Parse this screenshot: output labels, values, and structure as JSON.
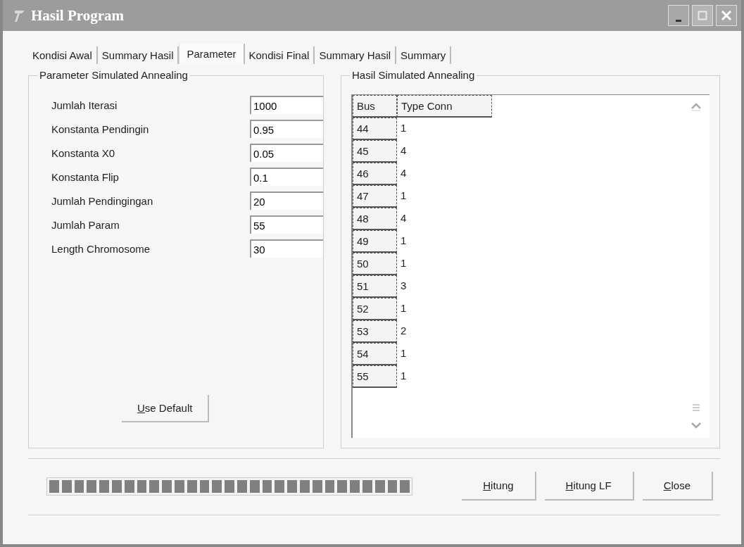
{
  "window": {
    "title": "Hasil Program"
  },
  "tabs": [
    {
      "label": "Kondisi Awal",
      "selected": false
    },
    {
      "label": "Summary Hasil",
      "selected": false
    },
    {
      "label": "Parameter",
      "selected": true
    },
    {
      "label": "Kondisi Final",
      "selected": false
    },
    {
      "label": "Summary Hasil",
      "selected": false
    },
    {
      "label": "Summary",
      "selected": false
    }
  ],
  "parameters": {
    "title": "Parameter Simulated Annealing",
    "fields": [
      {
        "label": "Jumlah Iterasi",
        "value": "1000"
      },
      {
        "label": "Konstanta Pendingin",
        "value": "0.95"
      },
      {
        "label": "Konstanta X0",
        "value": "0.05"
      },
      {
        "label": "Konstanta  Flip",
        "value": "0.1"
      },
      {
        "label": "Jumlah Pendingingan",
        "value": "20"
      },
      {
        "label": "Jumlah Param",
        "value": "55"
      },
      {
        "label": "Length Chromosome",
        "value": "30"
      }
    ],
    "button": "Use Default"
  },
  "results": {
    "title": "Hasil Simulated Annealing",
    "columns": [
      "Bus",
      "Type Conn"
    ],
    "rows": [
      [
        "44",
        "1"
      ],
      [
        "45",
        "4"
      ],
      [
        "46",
        "4"
      ],
      [
        "47",
        "1"
      ],
      [
        "48",
        "4"
      ],
      [
        "49",
        "1"
      ],
      [
        "50",
        "1"
      ],
      [
        "51",
        "3"
      ],
      [
        "52",
        "1"
      ],
      [
        "53",
        "2"
      ],
      [
        "54",
        "1"
      ],
      [
        "55",
        "1"
      ]
    ]
  },
  "progress": {
    "level": 1
  },
  "buttons": [
    "Hitung",
    "Hitung LF",
    "Close"
  ]
}
